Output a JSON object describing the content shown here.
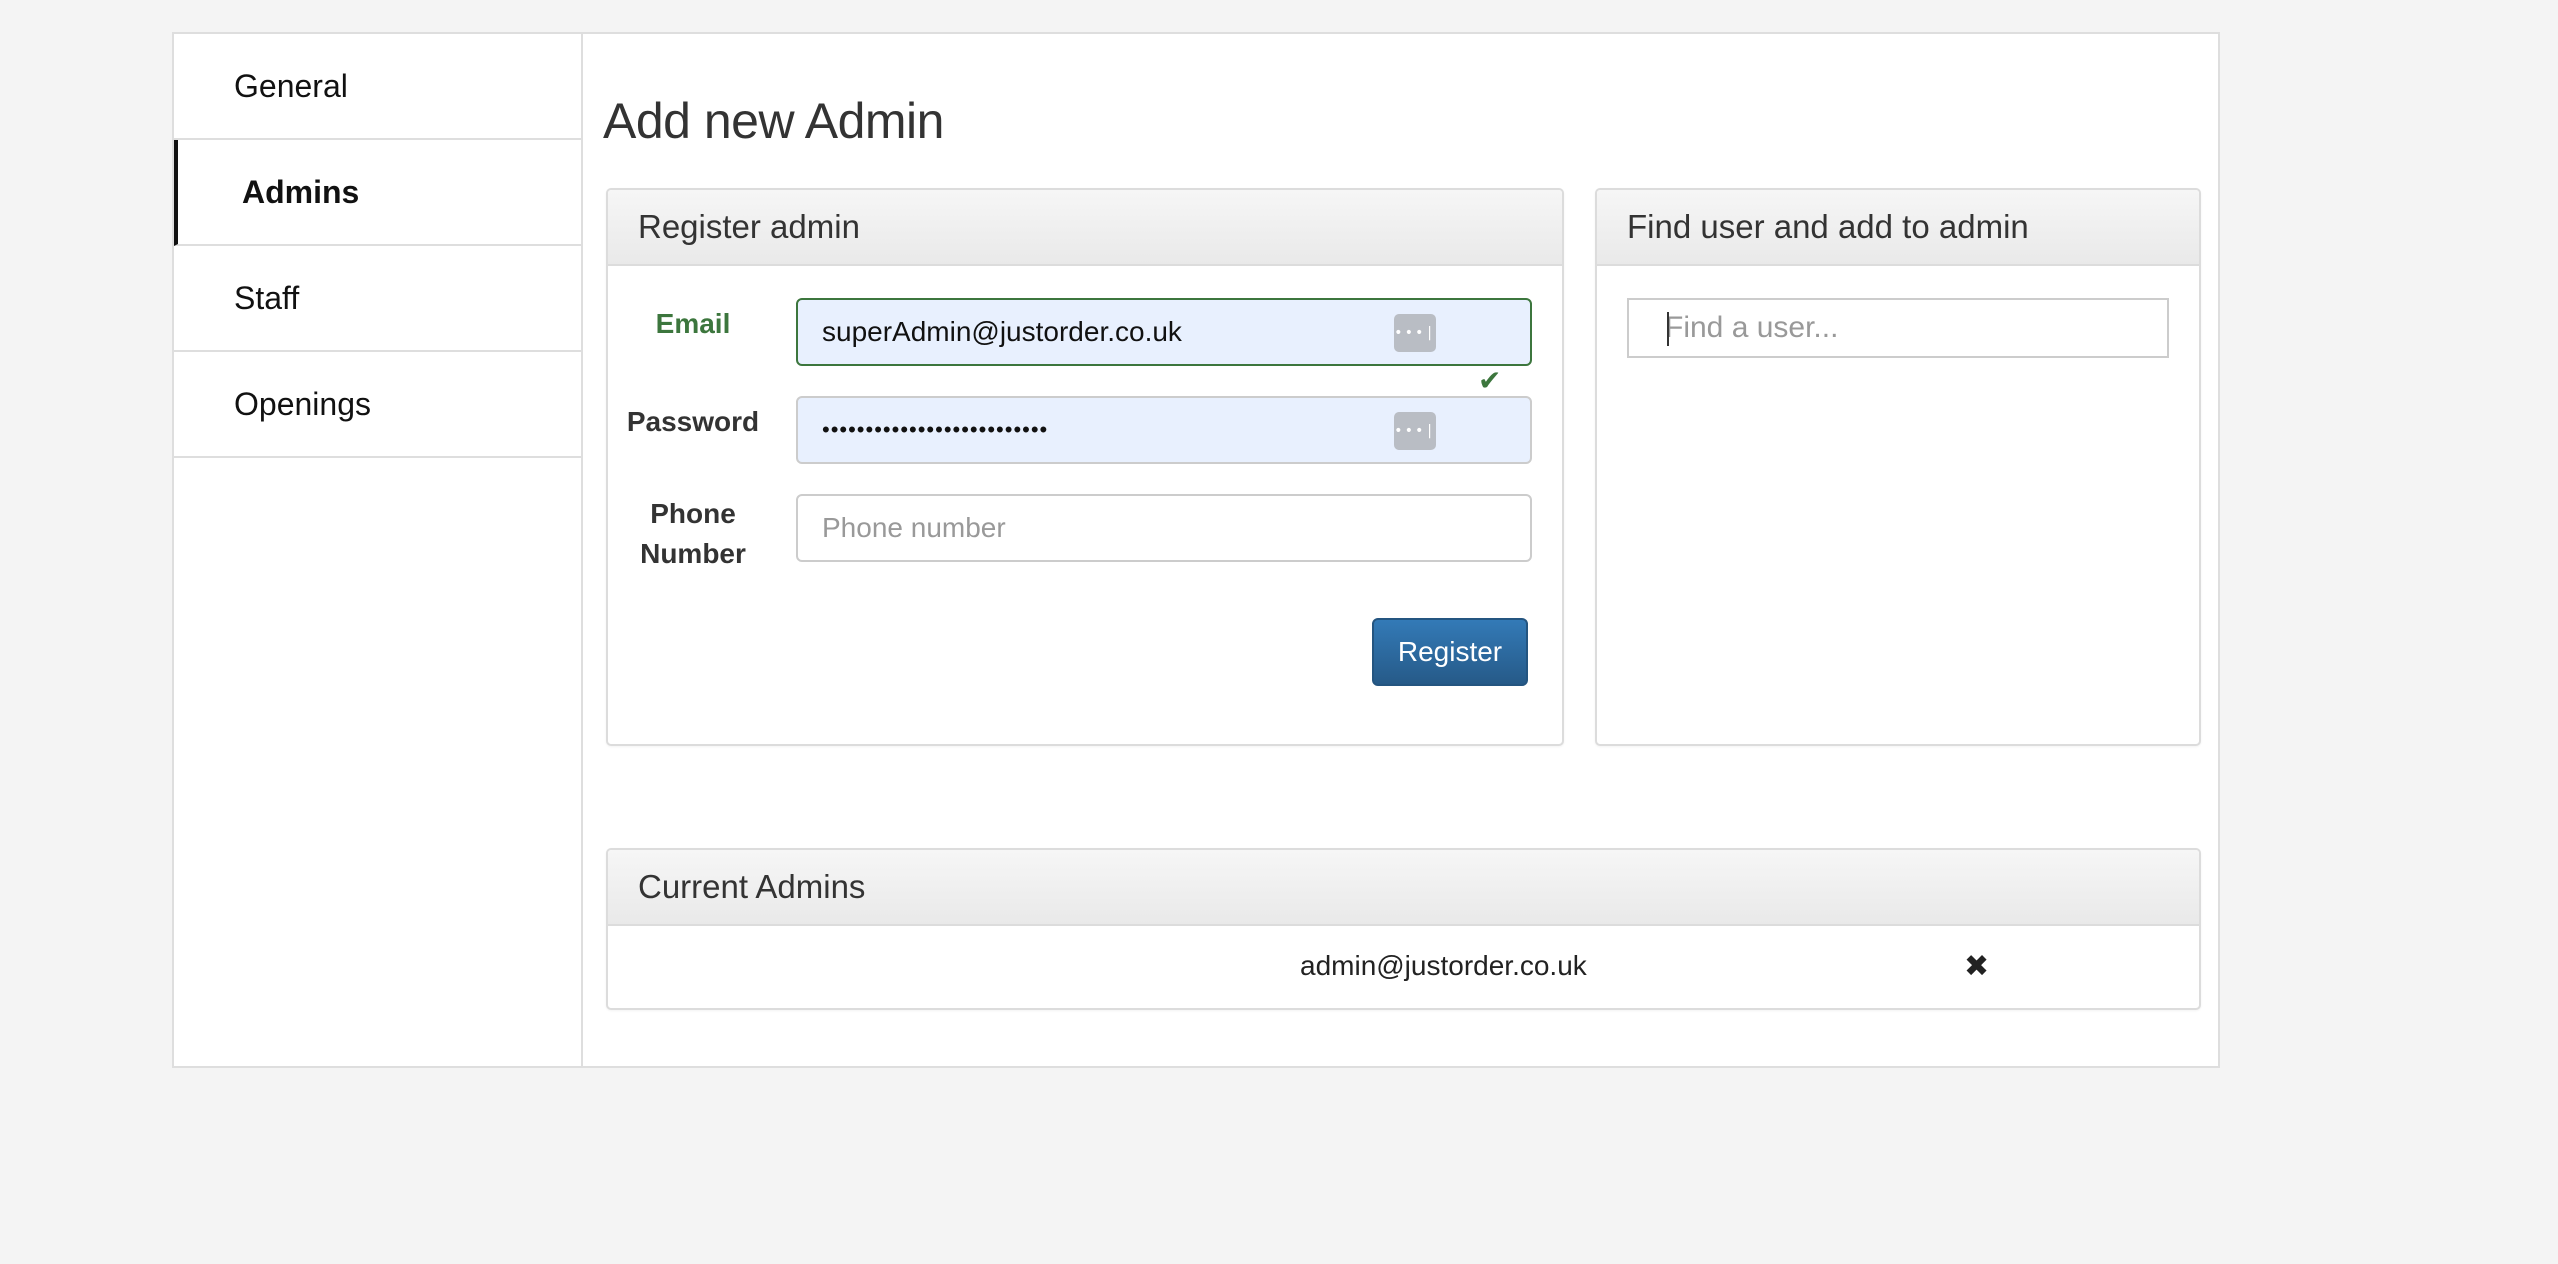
{
  "sidebar": {
    "items": [
      {
        "label": "General",
        "active": false
      },
      {
        "label": "Admins",
        "active": true
      },
      {
        "label": "Staff",
        "active": false
      },
      {
        "label": "Openings",
        "active": false
      }
    ]
  },
  "main": {
    "title": "Add new Admin",
    "register_panel": {
      "heading": "Register admin",
      "email_label": "Email",
      "email_value": "superAdmin@justorder.co.uk",
      "password_label": "Password",
      "password_value": "••••••••••••••••••••••••••",
      "phone_label_line1": "Phone",
      "phone_label_line2": "Number",
      "phone_placeholder": "Phone number",
      "register_button": "Register",
      "autofill_key_glyph": "•••|",
      "valid_icon_glyph": "✔"
    },
    "find_panel": {
      "heading": "Find user and add to admin",
      "search_placeholder": "Find a user..."
    },
    "current_admins": {
      "heading": "Current Admins",
      "admins": [
        {
          "email": "admin@justorder.co.uk",
          "remove_glyph": "✖"
        }
      ]
    }
  },
  "colors": {
    "success": "#3c763d",
    "primary": "#337ab7",
    "autofill": "#e8f0fe"
  }
}
